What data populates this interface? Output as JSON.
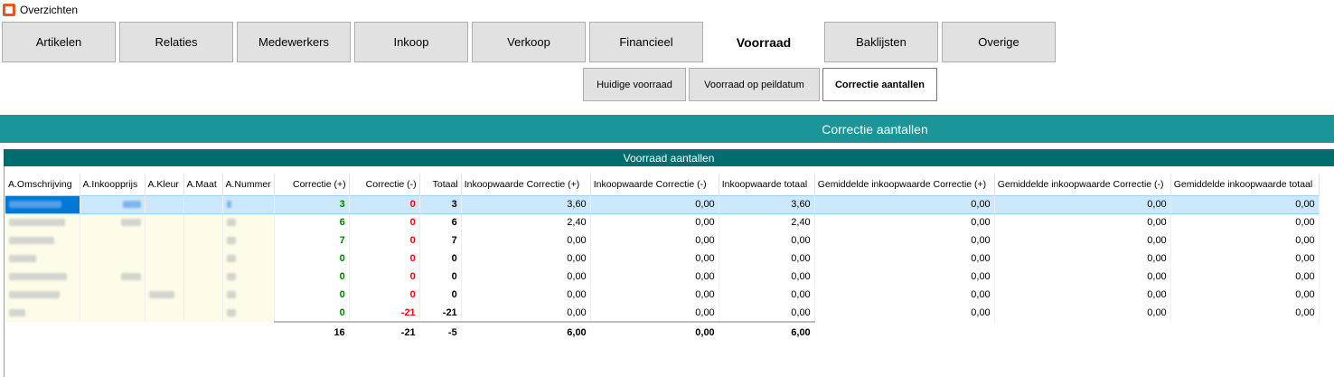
{
  "window": {
    "title": "Overzichten"
  },
  "tabs": [
    {
      "label": "Artikelen"
    },
    {
      "label": "Relaties"
    },
    {
      "label": "Medewerkers"
    },
    {
      "label": "Inkoop"
    },
    {
      "label": "Verkoop"
    },
    {
      "label": "Financieel"
    },
    {
      "label": "Voorraad",
      "active": true
    },
    {
      "label": "Baklijsten"
    },
    {
      "label": "Overige"
    }
  ],
  "subtabs": [
    {
      "label": "Huidige voorraad"
    },
    {
      "label": "Voorraad op peildatum"
    },
    {
      "label": "Correctie aantallen",
      "active": true
    }
  ],
  "banner": {
    "title": "Correctie aantallen"
  },
  "grid": {
    "group_title": "Voorraad aantallen",
    "columns": [
      "A.Omschrijving",
      "A.Inkoopprijs",
      "A.Kleur",
      "A.Maat",
      "A.Nummer",
      "Correctie (+)",
      "Correctie (-)",
      "Totaal",
      "Inkoopwaarde Correctie (+)",
      "Inkoopwaarde Correctie (-)",
      "Inkoopwaarde totaal",
      "Gemiddelde inkoopwaarde Correctie (+)",
      "Gemiddelde inkoopwaarde Correctie (-)",
      "Gemiddelde inkoopwaarde totaal"
    ],
    "rows": [
      {
        "plus": "3",
        "min": "0",
        "totaal": "3",
        "iw_plus": "3,60",
        "iw_min": "0,00",
        "iw_tot": "3,60",
        "g_plus": "0,00",
        "g_min": "0,00",
        "g_tot": "0,00"
      },
      {
        "plus": "6",
        "min": "0",
        "totaal": "6",
        "iw_plus": "2,40",
        "iw_min": "0,00",
        "iw_tot": "2,40",
        "g_plus": "0,00",
        "g_min": "0,00",
        "g_tot": "0,00"
      },
      {
        "plus": "7",
        "min": "0",
        "totaal": "7",
        "iw_plus": "0,00",
        "iw_min": "0,00",
        "iw_tot": "0,00",
        "g_plus": "0,00",
        "g_min": "0,00",
        "g_tot": "0,00"
      },
      {
        "plus": "0",
        "min": "0",
        "totaal": "0",
        "iw_plus": "0,00",
        "iw_min": "0,00",
        "iw_tot": "0,00",
        "g_plus": "0,00",
        "g_min": "0,00",
        "g_tot": "0,00"
      },
      {
        "plus": "0",
        "min": "0",
        "totaal": "0",
        "iw_plus": "0,00",
        "iw_min": "0,00",
        "iw_tot": "0,00",
        "g_plus": "0,00",
        "g_min": "0,00",
        "g_tot": "0,00"
      },
      {
        "plus": "0",
        "min": "0",
        "totaal": "0",
        "iw_plus": "0,00",
        "iw_min": "0,00",
        "iw_tot": "0,00",
        "g_plus": "0,00",
        "g_min": "0,00",
        "g_tot": "0,00"
      },
      {
        "plus": "0",
        "min": "-21",
        "totaal": "-21",
        "iw_plus": "0,00",
        "iw_min": "0,00",
        "iw_tot": "0,00",
        "g_plus": "0,00",
        "g_min": "0,00",
        "g_tot": "0,00"
      }
    ],
    "totals": {
      "plus": "16",
      "min": "-21",
      "totaal": "-5",
      "iw_plus": "6,00",
      "iw_min": "0,00",
      "iw_tot": "6,00"
    }
  },
  "colors": {
    "banner": "#1a9699",
    "group_header": "#006e6e",
    "positive": "#008000",
    "negative": "#ff0000",
    "selection": "#cce8ff"
  }
}
